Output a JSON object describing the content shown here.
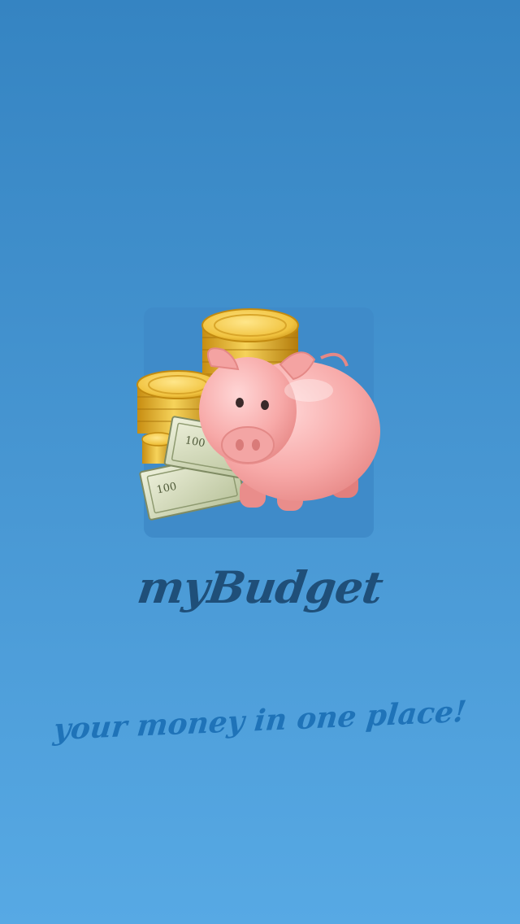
{
  "app": {
    "name": "myBudget",
    "tagline": "your money in one place!"
  },
  "logo": {
    "icon": "piggy-bank-icon",
    "banknote_text": "100"
  },
  "colors": {
    "background_top": "#3584c2",
    "background_bottom": "#57a9e4",
    "tile": "#3f8bc9",
    "app_name": "#1f4f79",
    "tagline": "#1f73b8"
  }
}
